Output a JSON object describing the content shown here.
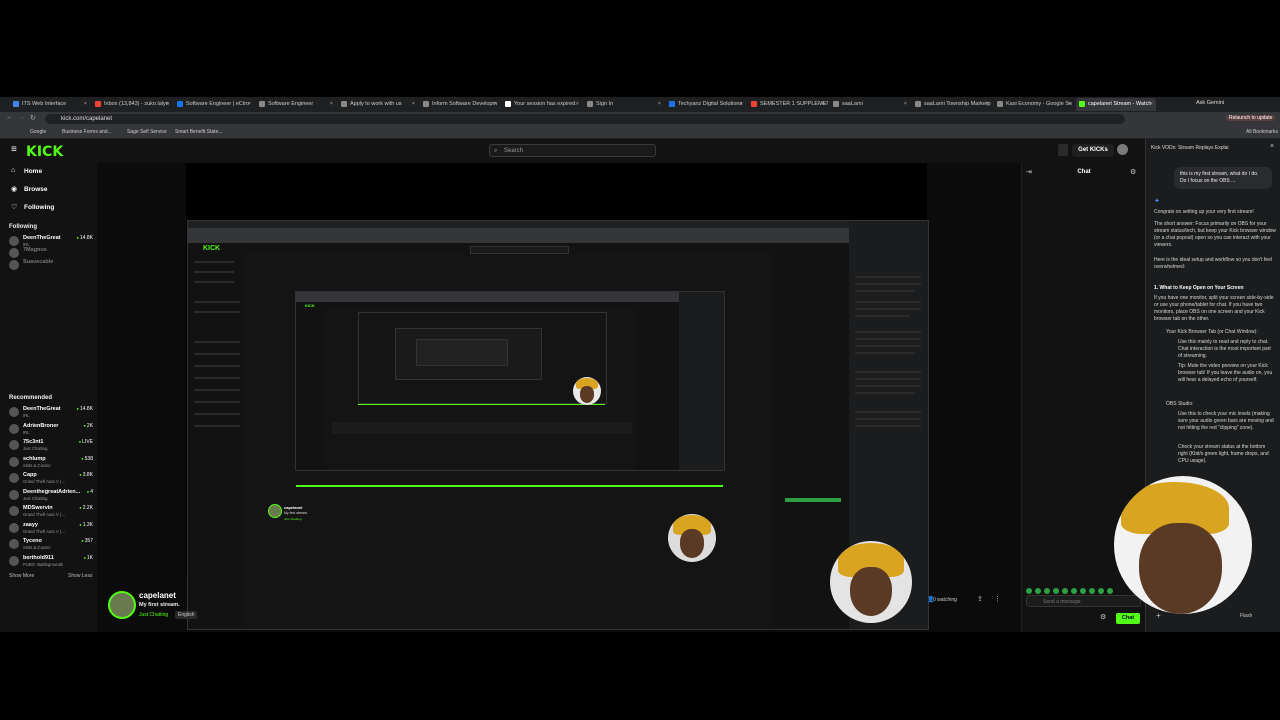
{
  "browser": {
    "tabs": [
      {
        "label": "ITS Web Interface",
        "color": "#4285f4"
      },
      {
        "label": "Inbox (13,843) - zuko.lalyo",
        "color": "#ea4335"
      },
      {
        "label": "Software Engineer | eCtro",
        "color": "#1a73e8"
      },
      {
        "label": "Software Engineer",
        "color": "#888888"
      },
      {
        "label": "Apply to work with us",
        "color": "#888888"
      },
      {
        "label": "Inform Software Developm",
        "color": "#888888"
      },
      {
        "label": "Your session has expired.",
        "color": "#ffffff"
      },
      {
        "label": "Sign In",
        "color": "#888888"
      },
      {
        "label": "Techyanz Digital Solutions",
        "color": "#1a73e8"
      },
      {
        "label": "SEMESTER 1 SUPPLEMENT",
        "color": "#ea4335"
      },
      {
        "label": "saaLami",
        "color": "#888888"
      },
      {
        "label": "saaLami Township Marketp",
        "color": "#888888"
      },
      {
        "label": "Kasi Economy - Google Se",
        "color": "#888888"
      },
      {
        "label": "capelanet Stream - Watch",
        "color": "#53fc18"
      }
    ],
    "ask_gemini": "Ask Gemini",
    "url": "kick.com/capelanet",
    "relaunch": "Relaunch to update",
    "bookmarks": [
      "Google",
      "Business Forms and...",
      "Sage Self Service",
      "Smart Benefit State..."
    ],
    "all_bookmarks": "All Bookmarks"
  },
  "kick": {
    "logo": "KICK",
    "search_placeholder": "Search",
    "get_kicks": "Get KICKs",
    "nav": [
      "Home",
      "Browse",
      "Following"
    ],
    "following_title": "Following",
    "following": [
      {
        "name": "DeenTheGreat",
        "sub": "IRL",
        "viewers": "14.8K",
        "online": true
      },
      {
        "name": "7Magnus",
        "sub": "",
        "viewers": "",
        "online": false
      },
      {
        "name": "Suavecable",
        "sub": "",
        "viewers": "",
        "online": false
      }
    ],
    "recommended_title": "Recommended",
    "recommended": [
      {
        "name": "DeenTheGreat",
        "sub": "IRL",
        "viewers": "14.8K"
      },
      {
        "name": "AdrienBroner",
        "sub": "IRL",
        "viewers": "2K"
      },
      {
        "name": "75c3nt1",
        "sub": "Just Chatting",
        "viewers": "LIVE"
      },
      {
        "name": "schlump",
        "sub": "Slots & Casino",
        "viewers": "538"
      },
      {
        "name": "Capp",
        "sub": "Grand Theft Auto V (...",
        "viewers": "3.8K"
      },
      {
        "name": "DeenthegreatAdrien...",
        "sub": "Just Chatting",
        "viewers": "4"
      },
      {
        "name": "MDSwervin",
        "sub": "Grand Theft Auto V (...",
        "viewers": "2.2K"
      },
      {
        "name": "zaayy",
        "sub": "Grand Theft Auto V (...",
        "viewers": "1.3K"
      },
      {
        "name": "Tyceno",
        "sub": "Slots & Casino",
        "viewers": "357"
      },
      {
        "name": "berthold911",
        "sub": "PUBG: Battlegrounds",
        "viewers": "1K"
      }
    ],
    "show_more": "Show More",
    "show_less": "Show Less",
    "streamer": "capelanet",
    "stream_title": "My first stream.",
    "category": "Just Chatting",
    "language": "English",
    "watching": "0 watching",
    "chat_title": "Chat",
    "chat_placeholder": "Send a message",
    "chat_button": "Chat"
  },
  "gemini": {
    "header": "Kick VODs: Stream Replays Explai",
    "question": "this is my first stream, what do I do. Do I focus on the OBS ...",
    "paragraphs": [
      "Congrats on setting up your very first stream!",
      "The short answer: Focus primarily on OBS for your stream status/tech, but keep your Kick browser window (or a chat popout) open so you can interact with your viewers.",
      "Here is the ideal setup and workflow so you don't feel overwhelmed:"
    ],
    "section1": "1. What to Keep Open on Your Screen",
    "section1_body": "If you have one monitor, split your screen side-by-side or use your phone/tablet for chat. If you have two monitors, place OBS on one screen and your Kick browser tab on the other.",
    "bullet1": "Your Kick Browser Tab (or Chat Window):",
    "bullet1_items": [
      "Use this mainly to read and reply to chat. Chat interaction is the most important part of streaming.",
      "Tip: Mute the video preview on your Kick browser tab! If you leave the audio on, you will hear a delayed echo of yourself."
    ],
    "bullet2": "OBS Studio:",
    "bullet2_items": [
      "Use this to check your mic levels (making sure your audio green bars are moving and not hitting the red \"clipping\" zone).",
      "Check your stream status at the bottom right (Kbit/s green light, frame drops, and CPU usage)."
    ],
    "footer_model": "Flash"
  }
}
